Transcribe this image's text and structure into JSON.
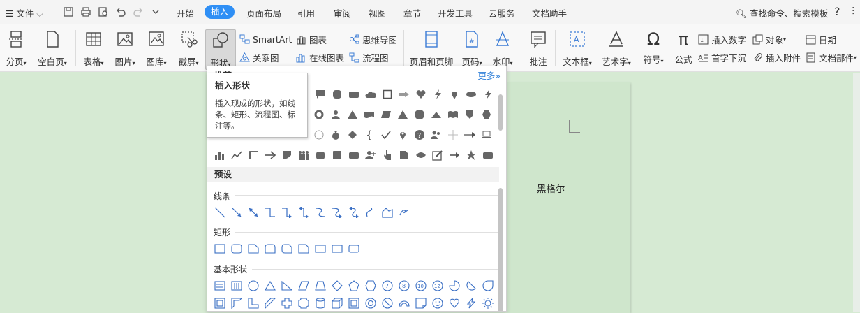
{
  "menubar": {
    "file_label": "文件",
    "tabs": [
      {
        "label": "开始"
      },
      {
        "label": "插入"
      },
      {
        "label": "页面布局"
      },
      {
        "label": "引用"
      },
      {
        "label": "审阅"
      },
      {
        "label": "视图"
      },
      {
        "label": "章节"
      },
      {
        "label": "开发工具"
      },
      {
        "label": "云服务"
      },
      {
        "label": "文档助手"
      }
    ],
    "active_tab": "插入",
    "search_label": "查找命令、搜索模板",
    "help_label": "?"
  },
  "ribbon": {
    "page_break": "分页",
    "blank_page": "空白页",
    "table": "表格",
    "picture": "图片",
    "gallery": "图库",
    "screenshot": "截屏",
    "shapes": "形状",
    "smartart": "SmartArt",
    "chart": "图表",
    "mindmap": "思维导图",
    "relation": "关系图",
    "online_chart": "在线图表",
    "flowchart": "流程图",
    "header_footer": "页眉和页脚",
    "page_number": "页码",
    "watermark": "水印",
    "comment": "批注",
    "textbox": "文本框",
    "wordart": "艺术字",
    "symbol": "符号",
    "formula": "公式",
    "insert_number": "插入数字",
    "object": "对象",
    "date": "日期",
    "drop_cap": "首字下沉",
    "attachment": "插入附件",
    "doc_parts": "文档部件"
  },
  "panel": {
    "recommend_label": "推荐",
    "more_label": "更多»",
    "preset_label": "预设",
    "lines_label": "线条",
    "rect_label": "矩形",
    "basic_label": "基本形状"
  },
  "tooltip": {
    "title": "插入形状",
    "body": "插入现成的形状，如线条、矩形、流程图、标注等。"
  },
  "document": {
    "text": "黑格尔"
  }
}
